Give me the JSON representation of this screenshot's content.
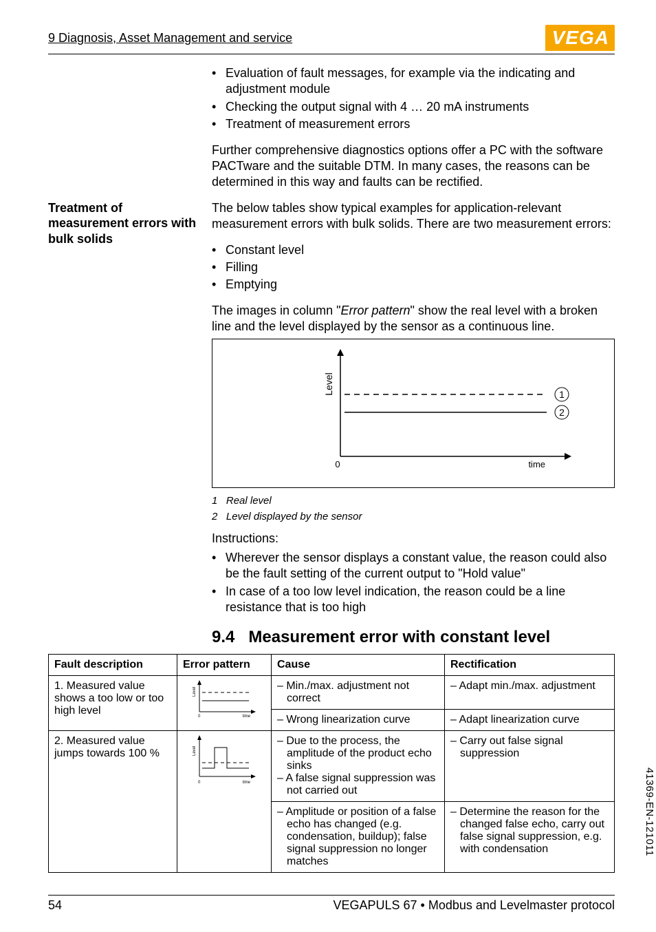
{
  "header": {
    "section_title": "9 Diagnosis, Asset Management and service",
    "logo_text": "VEGA"
  },
  "intro_bullets": [
    "Evaluation of fault messages, for example via the indicating and adjustment module",
    "Checking the output signal with 4 … 20 mA instruments",
    "Treatment of measurement errors"
  ],
  "intro_para": "Further comprehensive diagnostics options offer a PC with the software PACTware and the suitable DTM. In many cases, the reasons can be determined in this way and faults can be rectified.",
  "treatment": {
    "label": "Treatment of measurement errors with bulk solids",
    "intro": "The below tables show typical examples for application-relevant measurement errors with bulk solids. There are two measurement errors:",
    "bullets": [
      "Constant level",
      "Filling",
      "Emptying"
    ],
    "post": "The images in column \"Error pattern\" show the real level with a broken line and the level displayed by the sensor as a continuous line.",
    "caption1_num": "1",
    "caption1_txt": "Real level",
    "caption2_num": "2",
    "caption2_txt": "Level displayed by the sensor",
    "instructions_label": "Instructions:",
    "instruction_bullets": [
      "Wherever the sensor displays a constant value, the reason could also be the fault setting of the current output to \"Hold value\"",
      "In case of a too low level indication, the reason could be a line resistance that is too high"
    ]
  },
  "subsection": {
    "num": "9.4",
    "title": "Measurement error with constant level"
  },
  "table": {
    "headers": [
      "Fault description",
      "Error pattern",
      "Cause",
      "Rectification"
    ],
    "rows": [
      {
        "desc": "1. Measured value shows a too low or too high level",
        "pattern": "level-dashed-flat",
        "cells": [
          {
            "cause": "Min./max. adjustment not correct",
            "rect": "Adapt min./max. adjustment"
          },
          {
            "cause": "Wrong linearization curve",
            "rect": "Adapt linearization curve"
          }
        ]
      },
      {
        "desc": "2. Measured value jumps towards 100 %",
        "pattern": "level-step-pulse",
        "cells": [
          {
            "cause": "Due to the process, the amplitude of the product echo sinks\nA false signal suppression was not carried out",
            "rect": "Carry out false signal suppression"
          },
          {
            "cause": "Amplitude or position of a false echo has changed (e.g. condensation, buildup); false signal suppression no longer matches",
            "rect": "Determine the reason for the changed false echo, carry out false signal suppression, e.g. with condensation"
          }
        ]
      }
    ]
  },
  "figure_labels": {
    "y": "Level",
    "x": "time",
    "zero": "0",
    "m1": "1",
    "m2": "2"
  },
  "mini_labels": {
    "y": "Level",
    "x": "time",
    "zero": "0"
  },
  "footer": {
    "page": "54",
    "product": "VEGAPULS 67 • Modbus and Levelmaster protocol",
    "code": "41369-EN-121011"
  }
}
